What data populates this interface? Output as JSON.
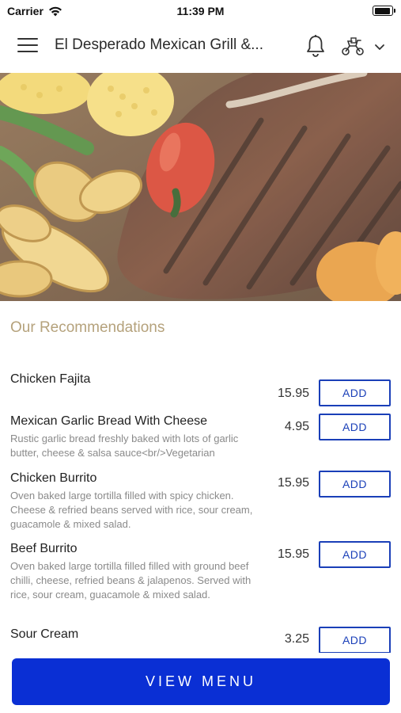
{
  "status_bar": {
    "carrier": "Carrier",
    "time": "11:39 PM"
  },
  "nav": {
    "title": "El Desperado Mexican Grill &...",
    "icons": [
      "hamburger-menu-icon",
      "bell-icon",
      "delivery-scooter-icon",
      "chevron-down-icon"
    ]
  },
  "hero": {
    "description_icon": "grilled-steak-with-vegetables-image"
  },
  "section": {
    "title": "Our Recommendations"
  },
  "items": [
    {
      "name": "Chicken Fajita",
      "description": "",
      "price": "15.95",
      "add_label": "ADD"
    },
    {
      "name": "Mexican Garlic Bread With Cheese",
      "description": "Rustic garlic bread freshly baked with lots of garlic butter, cheese & salsa sauce<br/>Vegetarian",
      "price": "4.95",
      "add_label": "ADD"
    },
    {
      "name": "Chicken Burrito",
      "description": "Oven baked large tortilla filled with spicy chicken. Cheese & refried beans served with rice, sour cream, guacamole & mixed salad.",
      "price": "15.95",
      "add_label": "ADD"
    },
    {
      "name": "Beef Burrito",
      "description": "Oven baked large tortilla filled filled with ground beef chilli, cheese, refried beans & jalapenos. Served with rice, sour cream, guacamole & mixed salad.",
      "price": "15.95",
      "add_label": "ADD"
    },
    {
      "name": "Sour Cream",
      "description": "",
      "price": "3.25",
      "add_label": "ADD"
    }
  ],
  "footer": {
    "view_menu_label": "VIEW MENU"
  },
  "colors": {
    "accent": "#1a3fb8",
    "button_bg": "#0a2fd4",
    "section_title": "#b5a27c"
  }
}
